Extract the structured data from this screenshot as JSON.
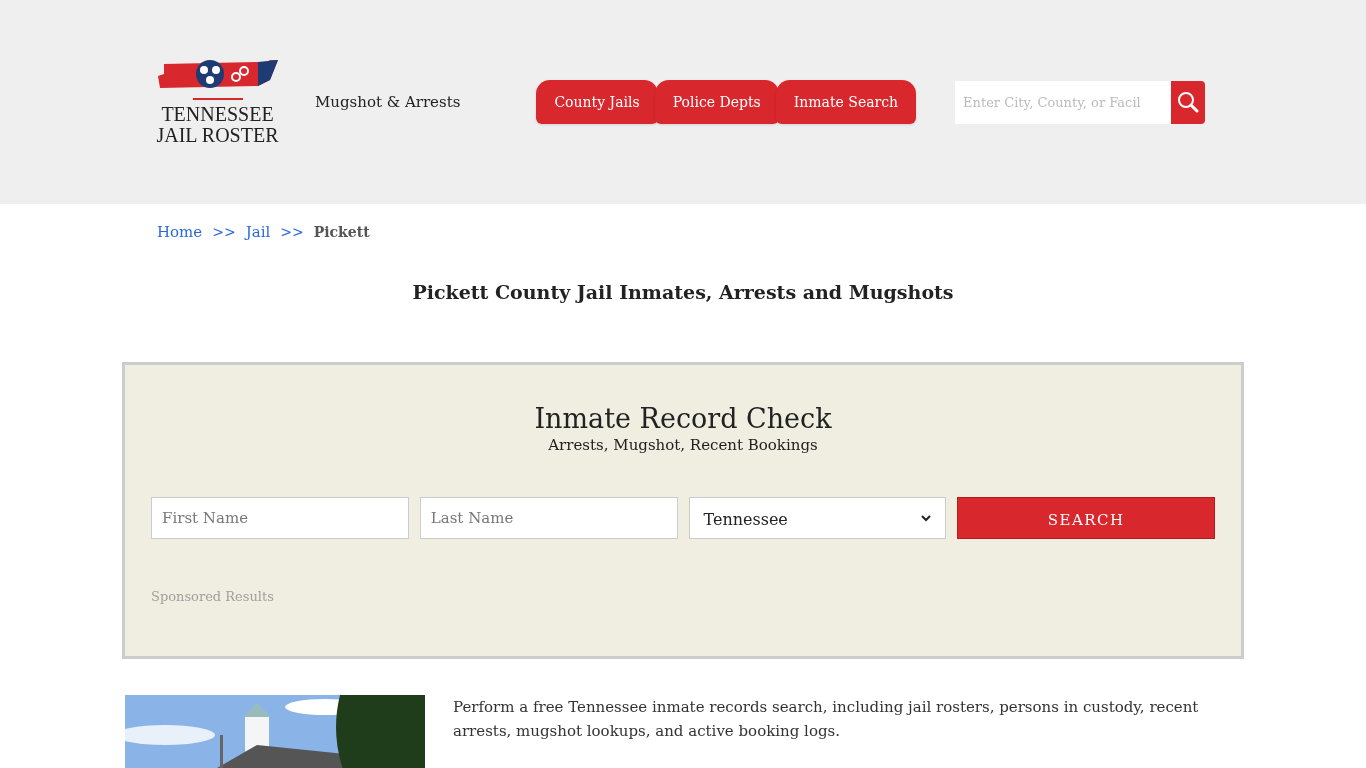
{
  "header": {
    "logo": {
      "line_1": "TENNESSEE",
      "line_2": "JAIL ROSTER"
    },
    "tagline": "Mugshot & Arrests",
    "nav": [
      "County Jails",
      "Police Depts",
      "Inmate Search"
    ],
    "search": {
      "placeholder": "Enter City, County, or Facil"
    }
  },
  "breadcrumb": [
    {
      "label": "Home",
      "link": true
    },
    {
      "label": "Jail",
      "link": true
    },
    {
      "label": "Pickett",
      "link": false
    }
  ],
  "breadcrumb_separator": ">>",
  "title": "Pickett County Jail Inmates, Arrests and Mugshots",
  "record_check": {
    "heading": "Inmate Record Check",
    "subheading": "Arrests, Mugshot, Recent Bookings",
    "first_name": {
      "placeholder": "First Name"
    },
    "last_name": {
      "placeholder": "Last Name"
    },
    "state": {
      "value": "Tennessee"
    },
    "button": "SEARCH",
    "sponsored": "Sponsored Results"
  },
  "content": {
    "paragraphs": [
      "Perform a free Tennessee inmate records search, including jail rosters, persons in custody, recent arrests, mugshot lookups, and active booking logs."
    ]
  }
}
